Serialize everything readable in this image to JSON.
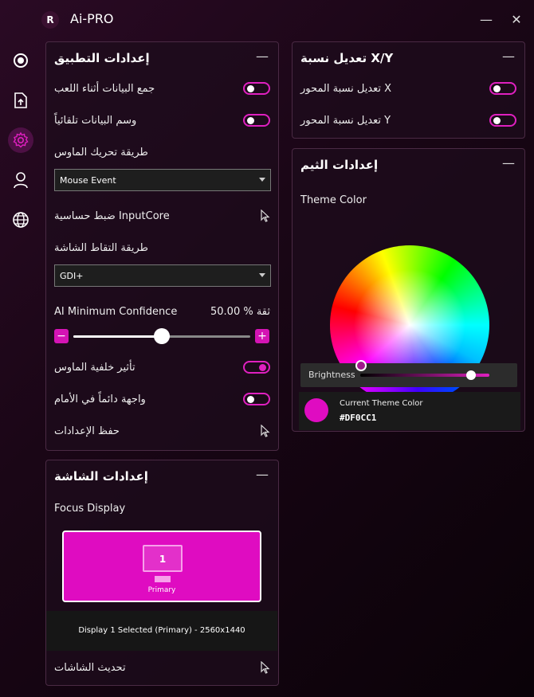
{
  "app": {
    "title": "Ai-PRO",
    "logo_letter": "R"
  },
  "window": {
    "minimize": "—",
    "close": "✕"
  },
  "sidebar": {
    "items": [
      {
        "icon": "record-icon"
      },
      {
        "icon": "export-icon"
      },
      {
        "icon": "gear-icon",
        "active": true
      },
      {
        "icon": "user-icon"
      },
      {
        "icon": "globe-icon"
      }
    ]
  },
  "app_settings": {
    "title": "إعدادات التطبيق",
    "collapse": "—",
    "collect_data_label": "جمع البيانات أثناء اللعب",
    "collect_data_on": false,
    "auto_label_label": "وسم البيانات تلقائياً",
    "auto_label_on": false,
    "mouse_method_label": "طريقة تحريك الماوس",
    "mouse_method_value": "Mouse Event",
    "inputcore_label": "ضبط حساسية InputCore",
    "capture_method_label": "طريقة التقاط الشاشة",
    "capture_method_value": "GDI+",
    "confidence_label": "AI Minimum Confidence",
    "confidence_value": "ثقة % 50.00",
    "confidence_fraction": 0.5,
    "minus": "−",
    "plus": "+",
    "mouse_bg_label": "تأثير خلفية الماوس",
    "mouse_bg_on": true,
    "always_front_label": "واجهة دائماً في الأمام",
    "always_front_on": false,
    "save_label": "حفظ الإعدادات"
  },
  "xy_settings": {
    "title": "تعديل نسبة X/Y",
    "collapse": "—",
    "x_label": "تعديل نسبة المحور X",
    "x_on": false,
    "y_label": "تعديل نسبة المحور Y",
    "y_on": false
  },
  "theme_settings": {
    "title": "إعدادات الثيم",
    "collapse": "—",
    "theme_color_label": "Theme Color",
    "brightness_label": "Brightness",
    "brightness_fraction": 0.86,
    "current_label": "Current Theme Color",
    "current_value": "#DF0CC1",
    "accent": "#DF0CC1"
  },
  "display_settings": {
    "title": "إعدادات الشاشة",
    "collapse": "—",
    "focus_label": "Focus Display",
    "monitor_number": "1",
    "monitor_label": "Primary",
    "selected_info": "Display 1 Selected (Primary) - 2560x1440",
    "refresh_label": "تحديث الشاشات"
  }
}
